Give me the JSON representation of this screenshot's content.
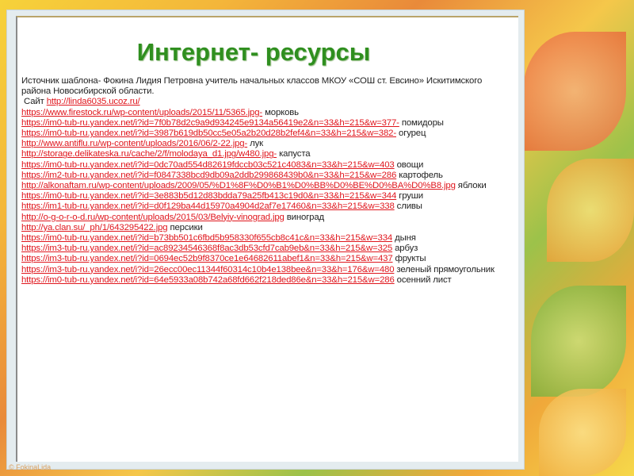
{
  "title": "Интернет- ресурсы",
  "intro": "Источник шаблона- Фокина Лидия Петровна учитель начальных классов МКОУ «СОШ ст. Евсино» Искитимского района Новосибирской области.",
  "site_label": "Сайт",
  "site_link": "http://linda6035.ucoz.ru/",
  "sources": [
    {
      "link": "https://www.firestock.ru/wp-content/uploads/2015/11/5365.jpg-",
      "label": "морковь"
    },
    {
      "link": "https://im0-tub-ru.yandex.net/i?id=7f0b78d2c9a9d934245e9134a56419e2&n=33&h=215&w=377-",
      "label": "помидоры"
    },
    {
      "link": "https://im0-tub-ru.yandex.net/i?id=3987b619db50cc5e05a2b20d28b2fef4&n=33&h=215&w=382-",
      "label": "огурец"
    },
    {
      "link": "http://www.antiflu.ru/wp-content/uploads/2016/06/2-22.jpg-",
      "label": "лук"
    },
    {
      "link": "http://storage.delikateska.ru/cache/2/f/molodaya_d1.jpg/w480.jpg-",
      "label": "капуста"
    },
    {
      "link": "https://im0-tub-ru.yandex.net/i?id=0dc70ad554d82619fdccb03c521c4083&n=33&h=215&w=403",
      "label": "овощи"
    },
    {
      "link": "https://im2-tub-ru.yandex.net/i?id=f0847338bcd9db09a2ddb299868439b0&n=33&h=215&w=286",
      "label": "картофель"
    },
    {
      "link": "http://alkonaftam.ru/wp-content/uploads/2009/05/%D1%8F%D0%B1%D0%BB%D0%BE%D0%BA%D0%B8.jpg",
      "label": "яблоки"
    },
    {
      "link": "https://im0-tub-ru.yandex.net/i?id=3e883b5d12d83bdda79a25fb413c19d0&n=33&h=215&w=344",
      "label": "груши"
    },
    {
      "link": "https://im1-tub-ru.yandex.net/i?id=d0f129ba44d15970a4904d2af7e17460&n=33&h=215&w=338",
      "label": "сливы"
    },
    {
      "link": "http://o-g-o-r-o-d.ru/wp-content/uploads/2015/03/Belyiy-vinograd.jpg",
      "label": "виноград"
    },
    {
      "link": "http://ya.clan.su/_ph/1/643295422.jpg",
      "label": "персики"
    },
    {
      "link": "https://im0-tub-ru.yandex.net/i?id=b73bb501c6fbd5b958330f655cb8c41c&n=33&h=215&w=334",
      "label": "дыня"
    },
    {
      "link": "https://im3-tub-ru.yandex.net/i?id=ac89234546368f8ac3db53cfd7cab9eb&n=33&h=215&w=325",
      "label": "арбуз"
    },
    {
      "link": "https://im3-tub-ru.yandex.net/i?id=0694ec52b9f8370ce1e64682611abef1&n=33&h=215&w=437",
      "label": "фрукты"
    },
    {
      "link": "https://im3-tub-ru.yandex.net/i?id=26ecc00ec11344f60314c10b4e138bee&n=33&h=176&w=480",
      "label": "зеленый прямоугольник"
    },
    {
      "link": "https://im0-tub-ru.yandex.net/i?id=64e5933a08b742a68fd662f218ded86e&n=33&h=215&w=286",
      "label": "осенний лист"
    }
  ],
  "copyright": "© FokinaLida",
  "colors": {
    "title": "#2f8f1f",
    "link": "#e0161d"
  }
}
